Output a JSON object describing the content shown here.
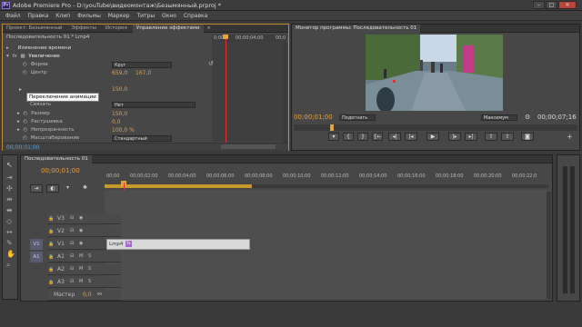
{
  "window": {
    "app_badge": "Pr",
    "title": "Adobe Premiere Pro - D:\\youTube\\видеомонтаж\\Безымянный.prproj *",
    "min": "–",
    "max": "□",
    "close": "✕"
  },
  "menu": [
    "Файл",
    "Правка",
    "Клип",
    "Фильмы",
    "Маркер",
    "Титры",
    "Окно",
    "Справка"
  ],
  "left_panel": {
    "tabs": [
      "Проект: Безымянный",
      "Эффекты",
      "История",
      "Управление эффектами"
    ],
    "close_glyph": "×",
    "crumb": "Последовательность 01 * Lmp4",
    "ruler_start": "0:00",
    "ruler_mid": "00;00;04;00",
    "ruler_end": "00;0",
    "section": "Изменение времени",
    "effect_name": "Увеличение",
    "props": {
      "forma_label": "Форма",
      "forma_value": "Круг",
      "center_label": "Центр",
      "center_x": "659,0",
      "center_y": "167,0",
      "tooltip": "Переключение анимации",
      "second_val": "150,0",
      "link_label": "Связать",
      "link_value": "Нет",
      "size_label": "Размер",
      "size_value": "150,0",
      "feather_label": "Растушевка",
      "feather_value": "0,0",
      "opacity_label": "Непрозрачность",
      "opacity_value": "100,0 %",
      "scale_label": "Масштабирование",
      "scale_value": "Стандартный"
    },
    "timecode": "00;00;01;00"
  },
  "monitor": {
    "tab": "Монитор программы: Последовательность 01",
    "timecode_left": "00;00;01;00",
    "fit_value": "Подогнать",
    "quality_value": "Максимум",
    "timecode_right": "00;00;07;16"
  },
  "timeline": {
    "tab": "Последовательность 01",
    "timecode": "00;00;01;00",
    "ruler": [
      "00;00",
      "00;00;02;00",
      "00;00;04;00",
      "00;00;06;00",
      "00;00;08;00",
      "00;00;10;00",
      "00;00;12;00",
      "00;00;14;00",
      "00;00;16;00",
      "00;00;18;00",
      "00;00;20;00",
      "00;00;22;0"
    ],
    "tracks": [
      {
        "label": "V3"
      },
      {
        "label": "V2"
      },
      {
        "label": "V1",
        "src": "V1"
      },
      {
        "label": "A1",
        "src": "A1",
        "m": "M",
        "s": "S"
      },
      {
        "label": "A2",
        "m": "M",
        "s": "S"
      },
      {
        "label": "A3",
        "m": "M",
        "s": "S"
      }
    ],
    "master_label": "Мастер",
    "master_value": "0,0",
    "clip_label": "Lmp4",
    "clip_badge": "fx"
  },
  "colors": {
    "accent": "#e8a23a",
    "playhead": "#e03030",
    "blue_value": "#5aa6e6",
    "clip": "#d9d9d9"
  }
}
